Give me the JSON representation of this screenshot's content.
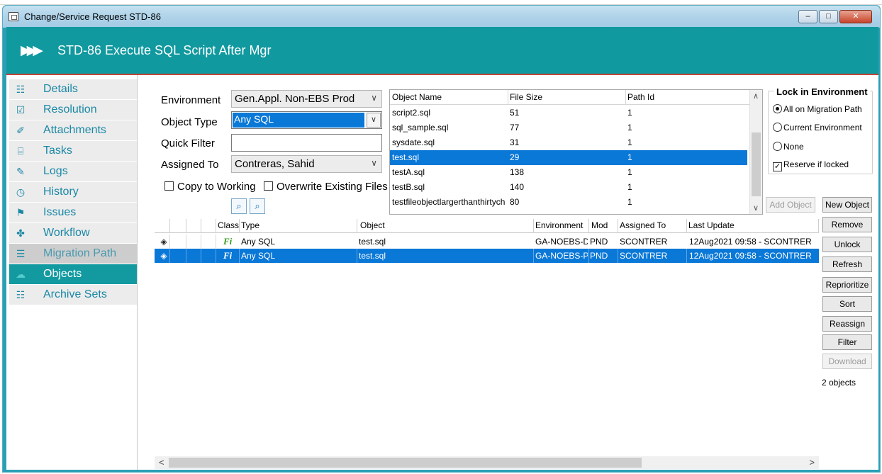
{
  "window": {
    "title": "Change/Service Request STD-86",
    "minimize": "–",
    "maximize": "□",
    "close": "✕"
  },
  "header": {
    "arrows": "▶▶▶",
    "title": "STD-86  Execute SQL Script After Mgr"
  },
  "sidebar": {
    "items": [
      {
        "label": "Details",
        "icon": "☷"
      },
      {
        "label": "Resolution",
        "icon": "☑"
      },
      {
        "label": "Attachments",
        "icon": "✐"
      },
      {
        "label": "Tasks",
        "icon": "⌸"
      },
      {
        "label": "Logs",
        "icon": "✎"
      },
      {
        "label": "History",
        "icon": "◷"
      },
      {
        "label": "Issues",
        "icon": "⚑"
      },
      {
        "label": "Workflow",
        "icon": "✤"
      },
      {
        "label": "Migration Path",
        "icon": "☰"
      },
      {
        "label": "Objects",
        "icon": "☁"
      },
      {
        "label": "Archive Sets",
        "icon": "☷"
      }
    ]
  },
  "form": {
    "environment_label": "Environment",
    "environment_value": "Gen.Appl. Non-EBS Prod",
    "object_type_label": "Object Type",
    "object_type_value": "Any SQL",
    "quick_filter_label": "Quick Filter",
    "quick_filter_value": "",
    "assigned_to_label": "Assigned To",
    "assigned_to_value": "Contreras, Sahid",
    "copy_to_working": "Copy to Working",
    "overwrite_existing": "Overwrite Existing Files",
    "dropdown_arrow": "∨"
  },
  "object_list": {
    "columns": [
      "Object Name",
      "File Size",
      "Path Id"
    ],
    "rows": [
      {
        "name": "script2.sql",
        "size": "51",
        "path": "1"
      },
      {
        "name": "sql_sample.sql",
        "size": "77",
        "path": "1"
      },
      {
        "name": "sysdate.sql",
        "size": "31",
        "path": "1"
      },
      {
        "name": "test.sql",
        "size": "29",
        "path": "1"
      },
      {
        "name": "testA.sql",
        "size": "138",
        "path": "1"
      },
      {
        "name": "testB.sql",
        "size": "140",
        "path": "1"
      },
      {
        "name": "testfileobjectlargerthanthirtych",
        "size": "80",
        "path": "1"
      }
    ],
    "selected_index": 3,
    "scroll_up": "∧",
    "scroll_down": "∨"
  },
  "lock": {
    "title": "Lock in Environment",
    "options": [
      "All on Migration Path",
      "Current Environment",
      "None"
    ],
    "selected": 0,
    "reserve_label": "Reserve if locked",
    "reserve_checked": true,
    "check_mark": "✓"
  },
  "actions": {
    "add_object": "Add Object",
    "new_object": "New Object",
    "remove": "Remove",
    "unlock": "Unlock",
    "refresh": "Refresh",
    "reprioritize": "Reprioritize",
    "sort": "Sort",
    "reassign": "Reassign",
    "filter": "Filter",
    "download": "Download"
  },
  "object_count": "2 objects",
  "grid": {
    "columns": [
      "Class",
      "Type",
      "Object",
      "Environment",
      "Mod",
      "Assigned To",
      "Last Update"
    ],
    "rows": [
      {
        "class": "Fi",
        "type": "Any SQL",
        "object": "test.sql",
        "environment": "GA-NOEBS-D",
        "mod": "PND",
        "assigned": "SCONTRER",
        "updated": "12Aug2021 09:58 - SCONTRER",
        "lock": "◈"
      },
      {
        "class": "Fi",
        "type": "Any SQL",
        "object": "test.sql",
        "environment": "GA-NOEBS-P",
        "mod": "PND",
        "assigned": "SCONTRER",
        "updated": "12Aug2021 09:58 - SCONTRER",
        "lock": "◈"
      }
    ],
    "selected_index": 1
  },
  "scroll": {
    "left": "<",
    "right": ">"
  },
  "colors": {
    "teal": "#10999f",
    "selection": "#0a78d7",
    "link": "#1a88a5"
  }
}
